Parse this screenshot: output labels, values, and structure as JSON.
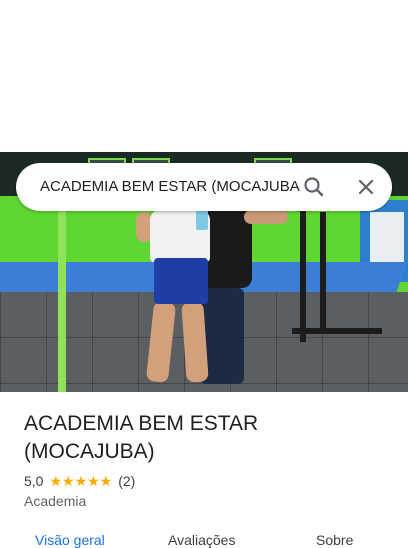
{
  "search": {
    "query": "ACADEMIA BEM ESTAR (MOCAJUBA"
  },
  "place": {
    "title_line1": "ACADEMIA BEM ESTAR",
    "title_line2": "(MOCAJUBA)",
    "rating": "5,0",
    "stars": "★★★★★",
    "review_count": "(2)",
    "category": "Academia"
  },
  "tabs": [
    {
      "label": "Visão geral"
    },
    {
      "label": "Avaliações"
    },
    {
      "label": "Sobre"
    }
  ],
  "colors": {
    "accent": "#1a73e8",
    "star": "#f9ab00"
  },
  "icons": {
    "search": "search-icon",
    "close": "close-icon"
  }
}
